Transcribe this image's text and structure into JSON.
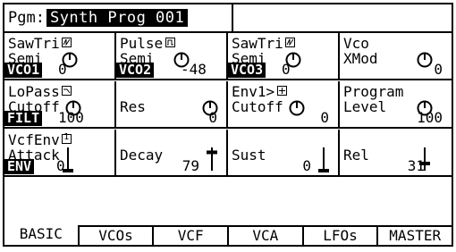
{
  "header": {
    "label": "Pgm:",
    "program_name": "Synth Prog 001"
  },
  "cells": [
    {
      "l1": "SawTri",
      "l2": "Semi",
      "icon": "saw-wave-icon",
      "knob": true,
      "section": "VCO1",
      "value": "0"
    },
    {
      "l1": "Pulse",
      "l2": "Semi",
      "icon": "pulse-wave-icon",
      "knob": true,
      "section": "VCO2",
      "value": "-48"
    },
    {
      "l1": "SawTri",
      "l2": "Semi",
      "icon": "saw-wave-icon",
      "knob": true,
      "section": "VCO3",
      "value": "0"
    },
    {
      "l1": "Vco",
      "l2": "XMod",
      "knob": true,
      "value": "0"
    },
    {
      "l1": "LoPass",
      "l2": "Cutoff",
      "icon": "lowpass-icon",
      "knob": true,
      "section": "FILT",
      "value": "100"
    },
    {
      "l1": "",
      "l2": "Res",
      "knob": true,
      "value": "0"
    },
    {
      "l1": "Env1>",
      "l2": "Cutoff",
      "icon": "plus-icon",
      "knob": true,
      "value": "0"
    },
    {
      "l1": "Program",
      "l2": "Level",
      "knob": true,
      "value": "100"
    },
    {
      "l1": "VcfEnv",
      "l2": "Attack",
      "icon": "env-1-icon",
      "icon_text": "1",
      "fader_level": 0.0,
      "section": "ENV",
      "value": "0"
    },
    {
      "l1": "",
      "l2": "Decay",
      "fader_level": 0.79,
      "value": "79"
    },
    {
      "l1": "",
      "l2": "Sust",
      "fader_level": 0.0,
      "value": "0"
    },
    {
      "l1": "",
      "l2": "Rel",
      "fader_level": 0.31,
      "value": "31"
    }
  ],
  "tabs": [
    {
      "label": "BASIC",
      "active": true
    },
    {
      "label": "VCOs",
      "active": false
    },
    {
      "label": "VCF",
      "active": false
    },
    {
      "label": "VCA",
      "active": false
    },
    {
      "label": "LFOs",
      "active": false
    },
    {
      "label": "MASTER",
      "active": false
    }
  ]
}
